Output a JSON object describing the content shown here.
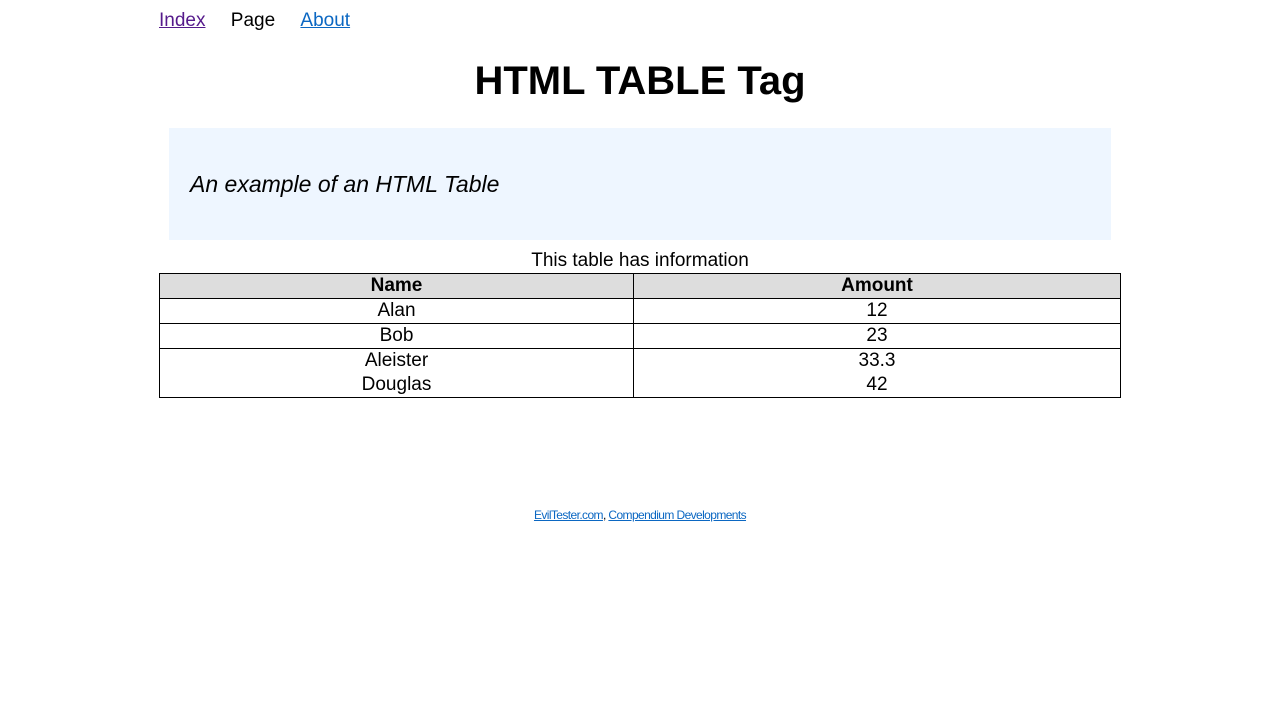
{
  "nav": {
    "items": [
      {
        "label": "Index",
        "state": "visited"
      },
      {
        "label": "Page",
        "state": "current"
      },
      {
        "label": "About",
        "state": "link"
      }
    ]
  },
  "page": {
    "title": "HTML TABLE Tag"
  },
  "callout": {
    "text": "An example of an HTML Table"
  },
  "table": {
    "caption": "This table has information",
    "headers": [
      "Name",
      "Amount"
    ],
    "rows": [
      {
        "name": "Alan",
        "amount": "12"
      },
      {
        "name": "Bob",
        "amount": "23"
      },
      {
        "name_lines": [
          "Aleister",
          "Douglas"
        ],
        "amount_lines": [
          "33.3",
          "42"
        ]
      }
    ]
  },
  "footer": {
    "link1": "EvilTester.com",
    "separator": ",",
    "link2": "Compendium Developments"
  },
  "colors": {
    "link": "#0b67c2",
    "visited_link": "#551a8b",
    "callout_bg": "#eef6ff",
    "header_bg": "#dddddd"
  }
}
